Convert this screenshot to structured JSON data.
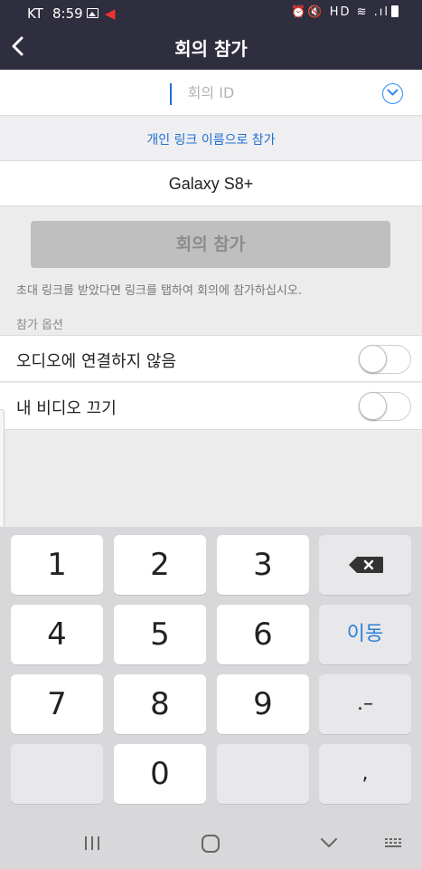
{
  "status_bar": {
    "carrier": "KT",
    "time": "8:59",
    "right_icons": "⏰🔇 HD ≋ .ıl"
  },
  "header": {
    "title": "회의 참가",
    "back_icon": "chevron-left-icon"
  },
  "meeting_id": {
    "placeholder": "회의 ID",
    "value": "",
    "dropdown_icon": "chevron-down-circle-icon"
  },
  "personal_link": {
    "label": "개인 링크 이름으로 참가"
  },
  "display_name": {
    "value": "Galaxy S8+"
  },
  "join_button": {
    "label": "회의 참가"
  },
  "hint_text": "초대 링크를 받았다면 링크를 탭하여 회의에 참가하십시오.",
  "options": {
    "section_label": "참가 옵션",
    "items": [
      {
        "label": "오디오에 연결하지 않음",
        "on": false
      },
      {
        "label": "내 비디오 끄기",
        "on": false
      }
    ]
  },
  "keypad": {
    "keys": [
      "1",
      "2",
      "3",
      "4",
      "5",
      "6",
      "7",
      "8",
      "9",
      "0"
    ],
    "next_label": "이동",
    "dot_dash": ".–",
    "comma": ","
  },
  "colors": {
    "header_bg": "#2e2e3f",
    "accent_blue": "#1f6fd1",
    "button_disabled": "#bfbfbf"
  }
}
